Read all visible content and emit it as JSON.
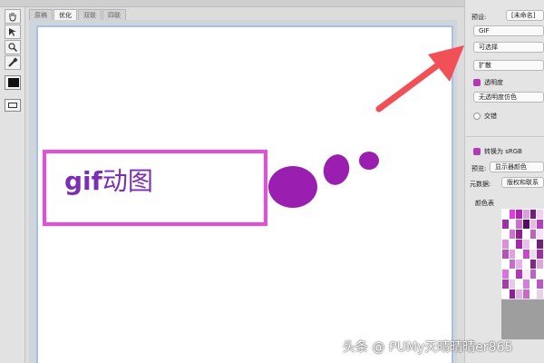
{
  "tabs": [
    {
      "label": "原稿",
      "active": false
    },
    {
      "label": "优化",
      "active": true
    },
    {
      "label": "双联",
      "active": false
    },
    {
      "label": "四联",
      "active": false
    }
  ],
  "canvas": {
    "text_latin": "gif",
    "text_han": "动图",
    "accent": "#e94ae0",
    "text_color": "#7b2fb6",
    "blob_color": "#9a1fb0"
  },
  "panel": {
    "preset_label": "预设:",
    "preset_value": "[未命名]",
    "format": "GIF",
    "reduction": "可选择",
    "dither": "扩散",
    "transparency_label": "透明度",
    "matte": "无透明度仿色",
    "interlace_label": "交错",
    "convert_label": "转换为 sRGB",
    "preview_label": "预览:",
    "preview_value": "显示器颜色",
    "metadata_label": "元数据:",
    "metadata_value": "版权和联系",
    "color_table_label": "颜色表"
  },
  "palette_colors": [
    "#ffffff",
    "#e03ce0",
    "#b020b8",
    "#d8a0d8",
    "#7a1880",
    "#f0d0f0",
    "#a030a8",
    "#ffffff",
    "#c870c8",
    "#501060",
    "#e8b8e8",
    "#b040b8",
    "#ffffff",
    "#d070d0",
    "#902090",
    "#ffffff",
    "#c060c0",
    "#f8e0f8",
    "#d890d8",
    "#ffffff",
    "#a828a8",
    "#e8c0e8",
    "#ffffff",
    "#702078",
    "#b850b8",
    "#e0a0e0",
    "#ffffff",
    "#c848c8",
    "#f0d8f0",
    "#9a30a0",
    "#ffffff",
    "#c070c8",
    "#e8b0e8",
    "#ffffff",
    "#802888",
    "#d8a8d8",
    "#e070e0",
    "#ffffff",
    "#b038b8",
    "#f8e8f8",
    "#c060c8",
    "#ffffff",
    "#a040a8",
    "#e8c8e8",
    "#ffffff",
    "#d080d8",
    "#ffffff",
    "#b858c0",
    "#ffffff",
    "#902098",
    "#e0b0e0",
    "#c868c8",
    "#ffffff",
    "#e8d0e8"
  ],
  "watermark": "头条 @ ᑭᑌMy天晴晴晴er865",
  "icons": {
    "tool1": "hand-icon",
    "tool2": "slice-select-icon",
    "tool3": "zoom-icon",
    "tool4": "eyedropper-icon"
  }
}
